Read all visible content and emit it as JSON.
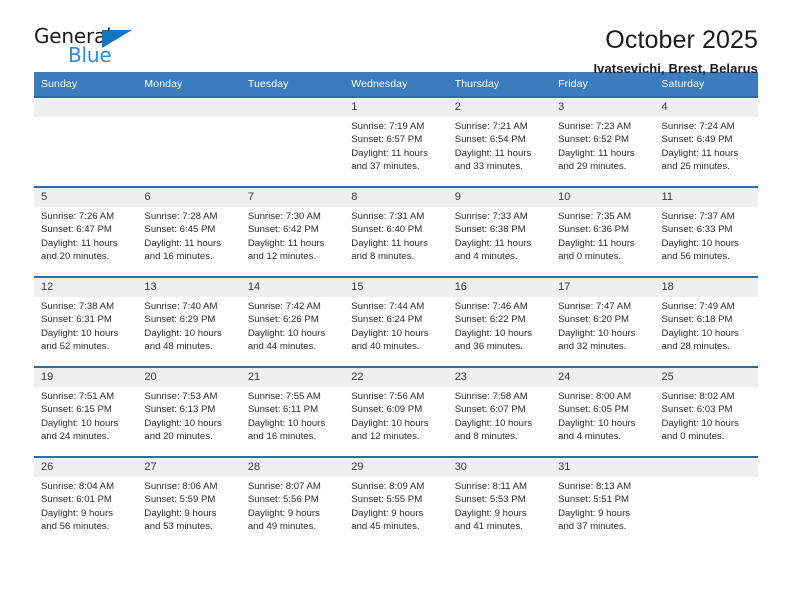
{
  "brand": {
    "word_one": "General",
    "word_two": "Blue",
    "triangle_icon": "triangle-icon",
    "accent_color": "#2e8bd0",
    "triangle_color": "#1574bb"
  },
  "header": {
    "title": "October 2025",
    "location": "Ivatsevichi, Brest, Belarus"
  },
  "theme": {
    "header_row_bg": "#3b7cbf",
    "row_border": "#2e6da4",
    "daynum_bg": "#efefef",
    "text": "#2c2c2c"
  },
  "calendar": {
    "weekday_headers": [
      "Sunday",
      "Monday",
      "Tuesday",
      "Wednesday",
      "Thursday",
      "Friday",
      "Saturday"
    ],
    "labels": {
      "sunrise": "Sunrise:",
      "sunset": "Sunset:",
      "daylight": "Daylight:"
    },
    "weeks": [
      [
        {
          "day": ""
        },
        {
          "day": ""
        },
        {
          "day": ""
        },
        {
          "day": "1",
          "sunrise": "Sunrise: 7:19 AM",
          "sunset": "Sunset: 6:57 PM",
          "daylight": "Daylight: 11 hours and 37 minutes."
        },
        {
          "day": "2",
          "sunrise": "Sunrise: 7:21 AM",
          "sunset": "Sunset: 6:54 PM",
          "daylight": "Daylight: 11 hours and 33 minutes."
        },
        {
          "day": "3",
          "sunrise": "Sunrise: 7:23 AM",
          "sunset": "Sunset: 6:52 PM",
          "daylight": "Daylight: 11 hours and 29 minutes."
        },
        {
          "day": "4",
          "sunrise": "Sunrise: 7:24 AM",
          "sunset": "Sunset: 6:49 PM",
          "daylight": "Daylight: 11 hours and 25 minutes."
        }
      ],
      [
        {
          "day": "5",
          "sunrise": "Sunrise: 7:26 AM",
          "sunset": "Sunset: 6:47 PM",
          "daylight": "Daylight: 11 hours and 20 minutes."
        },
        {
          "day": "6",
          "sunrise": "Sunrise: 7:28 AM",
          "sunset": "Sunset: 6:45 PM",
          "daylight": "Daylight: 11 hours and 16 minutes."
        },
        {
          "day": "7",
          "sunrise": "Sunrise: 7:30 AM",
          "sunset": "Sunset: 6:42 PM",
          "daylight": "Daylight: 11 hours and 12 minutes."
        },
        {
          "day": "8",
          "sunrise": "Sunrise: 7:31 AM",
          "sunset": "Sunset: 6:40 PM",
          "daylight": "Daylight: 11 hours and 8 minutes."
        },
        {
          "day": "9",
          "sunrise": "Sunrise: 7:33 AM",
          "sunset": "Sunset: 6:38 PM",
          "daylight": "Daylight: 11 hours and 4 minutes."
        },
        {
          "day": "10",
          "sunrise": "Sunrise: 7:35 AM",
          "sunset": "Sunset: 6:36 PM",
          "daylight": "Daylight: 11 hours and 0 minutes."
        },
        {
          "day": "11",
          "sunrise": "Sunrise: 7:37 AM",
          "sunset": "Sunset: 6:33 PM",
          "daylight": "Daylight: 10 hours and 56 minutes."
        }
      ],
      [
        {
          "day": "12",
          "sunrise": "Sunrise: 7:38 AM",
          "sunset": "Sunset: 6:31 PM",
          "daylight": "Daylight: 10 hours and 52 minutes."
        },
        {
          "day": "13",
          "sunrise": "Sunrise: 7:40 AM",
          "sunset": "Sunset: 6:29 PM",
          "daylight": "Daylight: 10 hours and 48 minutes."
        },
        {
          "day": "14",
          "sunrise": "Sunrise: 7:42 AM",
          "sunset": "Sunset: 6:26 PM",
          "daylight": "Daylight: 10 hours and 44 minutes."
        },
        {
          "day": "15",
          "sunrise": "Sunrise: 7:44 AM",
          "sunset": "Sunset: 6:24 PM",
          "daylight": "Daylight: 10 hours and 40 minutes."
        },
        {
          "day": "16",
          "sunrise": "Sunrise: 7:46 AM",
          "sunset": "Sunset: 6:22 PM",
          "daylight": "Daylight: 10 hours and 36 minutes."
        },
        {
          "day": "17",
          "sunrise": "Sunrise: 7:47 AM",
          "sunset": "Sunset: 6:20 PM",
          "daylight": "Daylight: 10 hours and 32 minutes."
        },
        {
          "day": "18",
          "sunrise": "Sunrise: 7:49 AM",
          "sunset": "Sunset: 6:18 PM",
          "daylight": "Daylight: 10 hours and 28 minutes."
        }
      ],
      [
        {
          "day": "19",
          "sunrise": "Sunrise: 7:51 AM",
          "sunset": "Sunset: 6:15 PM",
          "daylight": "Daylight: 10 hours and 24 minutes."
        },
        {
          "day": "20",
          "sunrise": "Sunrise: 7:53 AM",
          "sunset": "Sunset: 6:13 PM",
          "daylight": "Daylight: 10 hours and 20 minutes."
        },
        {
          "day": "21",
          "sunrise": "Sunrise: 7:55 AM",
          "sunset": "Sunset: 6:11 PM",
          "daylight": "Daylight: 10 hours and 16 minutes."
        },
        {
          "day": "22",
          "sunrise": "Sunrise: 7:56 AM",
          "sunset": "Sunset: 6:09 PM",
          "daylight": "Daylight: 10 hours and 12 minutes."
        },
        {
          "day": "23",
          "sunrise": "Sunrise: 7:58 AM",
          "sunset": "Sunset: 6:07 PM",
          "daylight": "Daylight: 10 hours and 8 minutes."
        },
        {
          "day": "24",
          "sunrise": "Sunrise: 8:00 AM",
          "sunset": "Sunset: 6:05 PM",
          "daylight": "Daylight: 10 hours and 4 minutes."
        },
        {
          "day": "25",
          "sunrise": "Sunrise: 8:02 AM",
          "sunset": "Sunset: 6:03 PM",
          "daylight": "Daylight: 10 hours and 0 minutes."
        }
      ],
      [
        {
          "day": "26",
          "sunrise": "Sunrise: 8:04 AM",
          "sunset": "Sunset: 6:01 PM",
          "daylight": "Daylight: 9 hours and 56 minutes."
        },
        {
          "day": "27",
          "sunrise": "Sunrise: 8:06 AM",
          "sunset": "Sunset: 5:59 PM",
          "daylight": "Daylight: 9 hours and 53 minutes."
        },
        {
          "day": "28",
          "sunrise": "Sunrise: 8:07 AM",
          "sunset": "Sunset: 5:56 PM",
          "daylight": "Daylight: 9 hours and 49 minutes."
        },
        {
          "day": "29",
          "sunrise": "Sunrise: 8:09 AM",
          "sunset": "Sunset: 5:55 PM",
          "daylight": "Daylight: 9 hours and 45 minutes."
        },
        {
          "day": "30",
          "sunrise": "Sunrise: 8:11 AM",
          "sunset": "Sunset: 5:53 PM",
          "daylight": "Daylight: 9 hours and 41 minutes."
        },
        {
          "day": "31",
          "sunrise": "Sunrise: 8:13 AM",
          "sunset": "Sunset: 5:51 PM",
          "daylight": "Daylight: 9 hours and 37 minutes."
        },
        {
          "day": ""
        }
      ]
    ]
  }
}
